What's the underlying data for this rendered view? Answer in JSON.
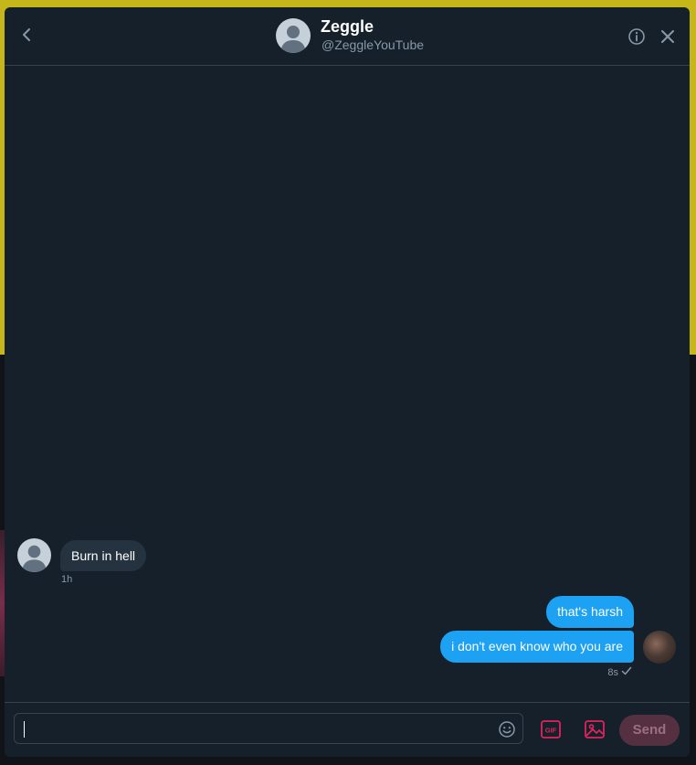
{
  "conversation": {
    "name": "Zeggle",
    "handle": "@ZeggleYouTube"
  },
  "messages": [
    {
      "direction": "received",
      "text": "Burn in hell",
      "time": "1h"
    },
    {
      "direction": "sent",
      "text": "that's harsh"
    },
    {
      "direction": "sent",
      "text": "i don't even know who you are",
      "time": "8s"
    }
  ],
  "composer": {
    "value": "",
    "placeholder": "",
    "gif_label": "GIF",
    "send_label": "Send"
  },
  "icons": {
    "back": "chevron-left-icon",
    "info": "info-icon",
    "close": "close-icon",
    "emoji": "emoji-icon",
    "gif": "gif-icon",
    "image": "image-icon",
    "read_receipt": "checkmark-icon"
  },
  "colors": {
    "accent": "#1da1f2",
    "send_button_disabled": "#553041",
    "composer_icon": "#e0245e",
    "modal_background": "#15202b"
  }
}
